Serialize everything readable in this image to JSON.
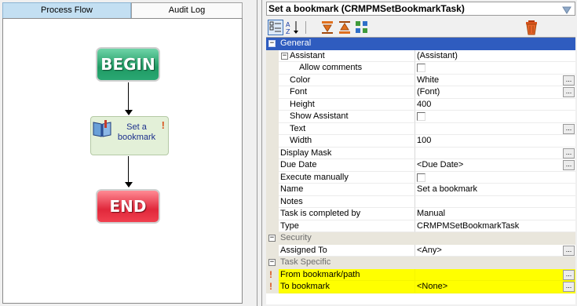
{
  "tabs": {
    "process_flow": "Process Flow",
    "audit_log": "Audit Log"
  },
  "flow": {
    "begin": "BEGIN",
    "task_line1": "Set a",
    "task_line2": "bookmark",
    "end": "END"
  },
  "inspector": {
    "object_title": "Set a bookmark (CRMPMSetBookmarkTask)",
    "toolbar": {
      "categorized": "categorized-icon",
      "alphabetical": "alphabetical-sort-icon",
      "move_down": "move-down-icon",
      "move_up": "move-up-icon",
      "properties": "properties-icon",
      "delete": "trash-icon"
    }
  },
  "grid": {
    "general": "General",
    "assistant": {
      "name": "Assistant",
      "value": "(Assistant)"
    },
    "allow_comments": {
      "name": "Allow comments"
    },
    "color": {
      "name": "Color",
      "value": "White"
    },
    "font": {
      "name": "Font",
      "value": "(Font)"
    },
    "height": {
      "name": "Height",
      "value": "400"
    },
    "show_assistant": {
      "name": "Show Assistant"
    },
    "text": {
      "name": "Text",
      "value": ""
    },
    "width": {
      "name": "Width",
      "value": "100"
    },
    "display_mask": {
      "name": "Display Mask",
      "value": ""
    },
    "due_date": {
      "name": "Due Date",
      "value": "<Due Date>"
    },
    "execute_manually": {
      "name": "Execute manually"
    },
    "name": {
      "name": "Name",
      "value": "Set a bookmark"
    },
    "notes": {
      "name": "Notes",
      "value": ""
    },
    "task_completed_by": {
      "name": "Task is completed by",
      "value": "Manual"
    },
    "type": {
      "name": "Type",
      "value": "CRMPMSetBookmarkTask"
    },
    "security": "Security",
    "assigned_to": {
      "name": "Assigned To",
      "value": "<Any>"
    },
    "task_specific": "Task Specific",
    "from_bookmark": {
      "name": "From bookmark/path",
      "value": ""
    },
    "to_bookmark": {
      "name": "To bookmark",
      "value": "<None>"
    }
  },
  "colors": {
    "selected_row": "#2f5cbf",
    "required_row": "#ffff00",
    "begin_green": "#1f9a63",
    "end_red": "#e0283b",
    "task_text": "#1c2f8c"
  }
}
